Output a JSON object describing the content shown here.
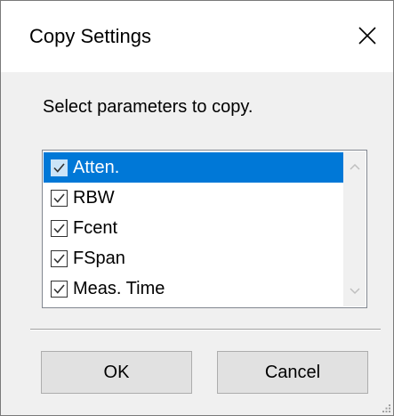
{
  "window": {
    "title": "Copy Settings",
    "close_icon": "close-icon"
  },
  "prompt": "Select parameters to copy.",
  "parameters": [
    {
      "label": "Atten.",
      "checked": true,
      "selected": true
    },
    {
      "label": "RBW",
      "checked": true,
      "selected": false
    },
    {
      "label": "Fcent",
      "checked": true,
      "selected": false
    },
    {
      "label": "FSpan",
      "checked": true,
      "selected": false
    },
    {
      "label": "Meas. Time",
      "checked": true,
      "selected": false
    }
  ],
  "buttons": {
    "ok_label": "OK",
    "cancel_label": "Cancel"
  },
  "colors": {
    "selection": "#0078d7",
    "dialog_background": "#f0f0f0"
  }
}
